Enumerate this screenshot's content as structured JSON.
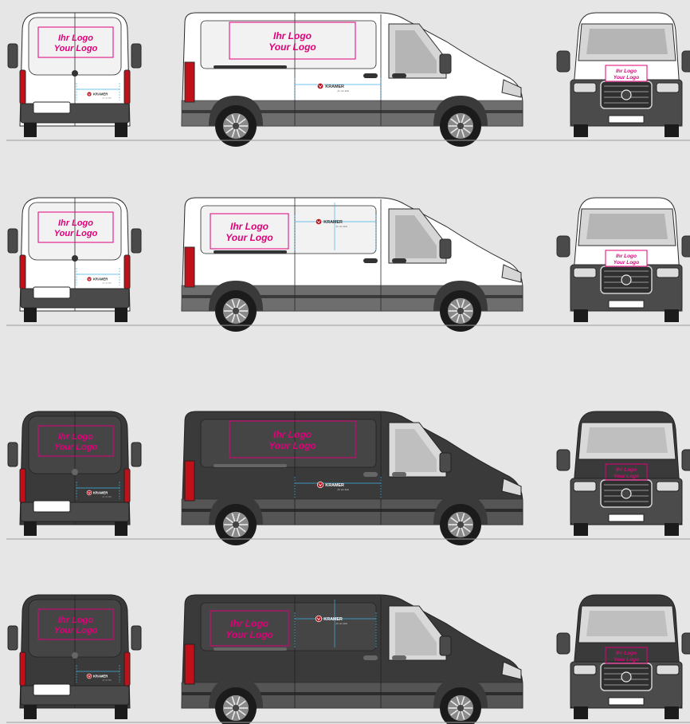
{
  "logo_placeholder": {
    "line1": "Ihr Logo",
    "line2": "Your Logo",
    "front_line1": "Ihr Logo",
    "front_line2": "Your Logo"
  },
  "brand": {
    "name": "KRAMER",
    "tagline": "for our kids"
  },
  "colors": {
    "background": "#e6e6e6",
    "accent_magenta": "#e0007a",
    "guide_cyan": "#3fb1e6",
    "white_body": "#ffffff",
    "dark_body": "#3d3d3d",
    "trim_grey": "#6b6b6b",
    "taillight_red": "#c0111a"
  },
  "variants": [
    {
      "id": "white-short-logo",
      "body": "white"
    },
    {
      "id": "white-large-logo",
      "body": "white"
    },
    {
      "id": "dark-short-logo",
      "body": "dark"
    },
    {
      "id": "dark-large-logo",
      "body": "dark"
    }
  ],
  "views": [
    "rear",
    "side",
    "front"
  ]
}
